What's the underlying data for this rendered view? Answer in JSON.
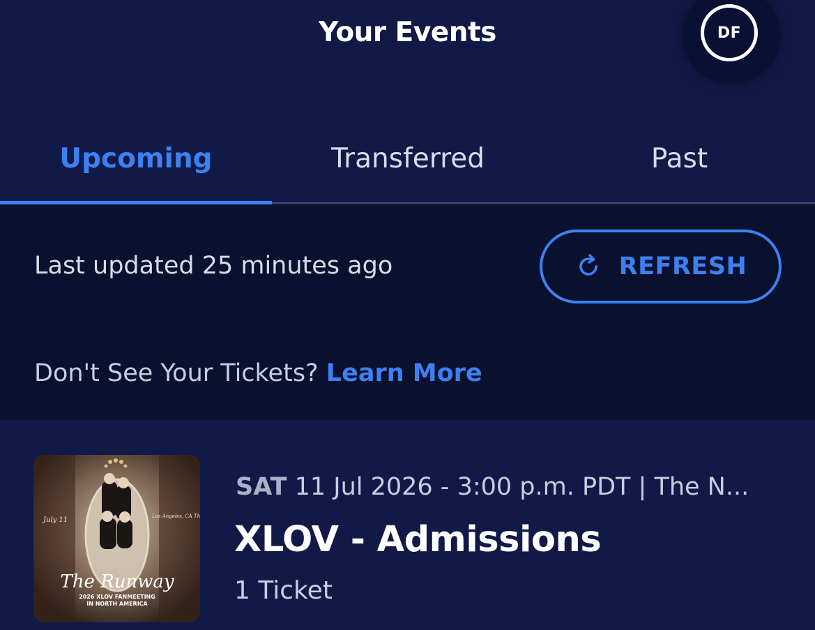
{
  "header": {
    "title": "Your Events",
    "avatar_initials": "DF"
  },
  "tabs": [
    {
      "label": "Upcoming",
      "active": true
    },
    {
      "label": "Transferred",
      "active": false
    },
    {
      "label": "Past",
      "active": false
    }
  ],
  "status": {
    "last_updated": "Last updated 25 minutes ago",
    "refresh_label": "REFRESH",
    "help_text": "Don't See Your Tickets?",
    "learn_more": "Learn More"
  },
  "event": {
    "day": "SAT",
    "datetime": "11 Jul 2026 - 3:00 p.m. PDT | The N...",
    "title": "XLOV - Admissions",
    "tickets": "1 Ticket",
    "poster": {
      "script_title": "The Runway",
      "left_note": "July 11",
      "right_note": "Los Angeles, CA The Novo",
      "subtitle_line1": "2026 XLOV FANMEETING",
      "subtitle_line2": "IN NORTH AMERICA"
    }
  },
  "colors": {
    "accent": "#3d80f0",
    "background": "#111a47",
    "panel": "#0a112e"
  }
}
